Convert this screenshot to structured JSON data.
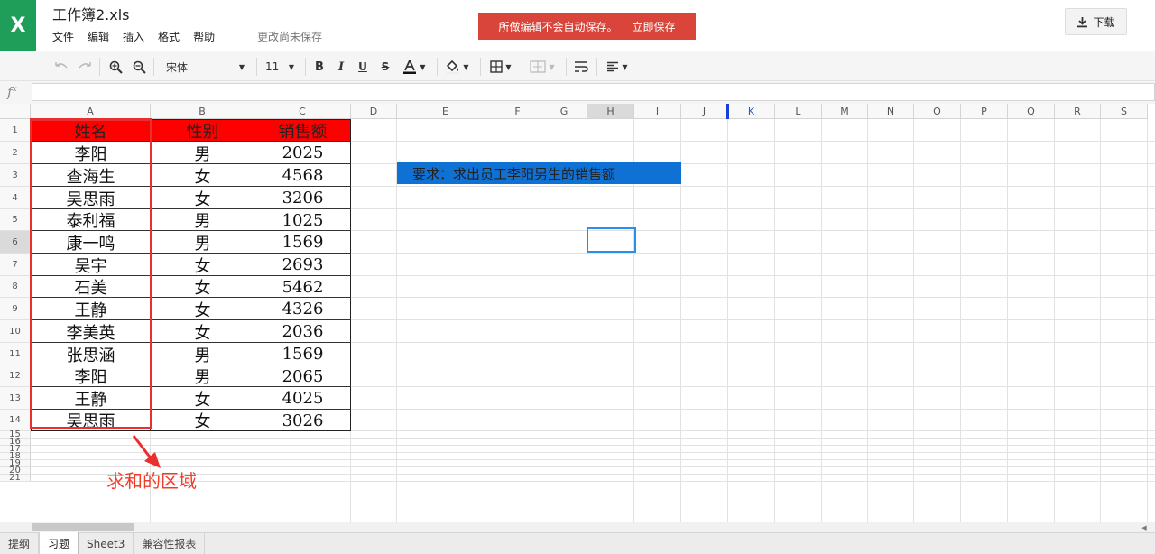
{
  "app": {
    "logo_glyph": "X",
    "title": "工作簿2.xls",
    "menu": [
      "文件",
      "编辑",
      "插入",
      "格式",
      "帮助"
    ],
    "unsaved_status": "更改尚未保存",
    "banner": {
      "message": "所做编辑不会自动保存。",
      "action": "立即保存",
      "color": "#d9453a"
    },
    "download_label": "下载",
    "accent_color": "#1e9e59"
  },
  "toolbar": {
    "font_name": "宋体",
    "font_size": "11",
    "icons": [
      "undo-icon",
      "redo-icon",
      "zoom-in-icon",
      "zoom-out-icon",
      "bold-icon",
      "italic-icon",
      "underline-icon",
      "strikethrough-icon",
      "font-color-icon",
      "fill-color-icon",
      "borders-icon",
      "merge-cells-icon",
      "wrap-text-icon",
      "align-icon"
    ]
  },
  "formula_bar": {
    "label": "fx",
    "value": ""
  },
  "grid": {
    "columns": [
      "A",
      "B",
      "C",
      "D",
      "E",
      "F",
      "G",
      "H",
      "I",
      "J",
      "K",
      "L",
      "M",
      "N",
      "O",
      "P",
      "Q",
      "R",
      "S"
    ],
    "rows": [
      "1",
      "2",
      "3",
      "4",
      "5",
      "6",
      "7",
      "8",
      "9",
      "10",
      "11",
      "12",
      "13",
      "14",
      "15",
      "16",
      "17",
      "18",
      "19",
      "20",
      "21"
    ],
    "selected_column": "H",
    "selected_row": "6",
    "table": {
      "headers": [
        "姓名",
        "性别",
        "销售额"
      ],
      "rows": [
        [
          "李阳",
          "男",
          "2025"
        ],
        [
          "查海生",
          "女",
          "4568"
        ],
        [
          "吴思雨",
          "女",
          "3206"
        ],
        [
          "泰利福",
          "男",
          "1025"
        ],
        [
          "康一鸣",
          "男",
          "1569"
        ],
        [
          "吴宇",
          "女",
          "2693"
        ],
        [
          "石美",
          "女",
          "5462"
        ],
        [
          "王静",
          "女",
          "4326"
        ],
        [
          "李美英",
          "女",
          "2036"
        ],
        [
          "张思涵",
          "男",
          "1569"
        ],
        [
          "李阳",
          "男",
          "2065"
        ],
        [
          "王静",
          "女",
          "4025"
        ],
        [
          "吴思雨",
          "女",
          "3026"
        ]
      ],
      "header_fill": "#ff0000"
    },
    "note": "要求：求出员工李阳男生的销售额",
    "note_fill": "#1071d4",
    "annotation": "求和的区域",
    "annotation_color": "#f03c2b"
  },
  "sheets": {
    "tabs": [
      "提纲",
      "习题",
      "Sheet3",
      "兼容性报表"
    ],
    "active": "习题"
  }
}
